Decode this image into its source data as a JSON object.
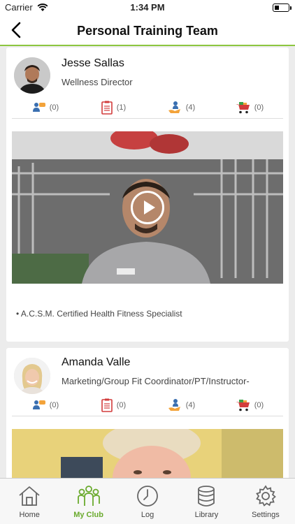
{
  "status_bar": {
    "carrier": "Carrier",
    "time": "1:34 PM"
  },
  "nav": {
    "title": "Personal Training Team"
  },
  "colors": {
    "accent": "#8cc63f",
    "active_tab": "#6aaa2d"
  },
  "trainers": [
    {
      "name": "Jesse Sallas",
      "title": "Wellness Director",
      "stats": {
        "messages": "(0)",
        "plans": "(1)",
        "sessions": "(4)",
        "store": "(0)"
      },
      "certification": "A.C.S.M. Certified Health Fitness Specialist"
    },
    {
      "name": "Amanda Valle",
      "title": "Marketing/Group Fit Coordinator/PT/Instructor-",
      "stats": {
        "messages": "(0)",
        "plans": "(0)",
        "sessions": "(4)",
        "store": "(0)"
      }
    }
  ],
  "tabs": [
    {
      "label": "Home",
      "icon": "home-icon"
    },
    {
      "label": "My Club",
      "icon": "my-club-icon",
      "active": true
    },
    {
      "label": "Log",
      "icon": "clock-icon"
    },
    {
      "label": "Library",
      "icon": "database-icon"
    },
    {
      "label": "Settings",
      "icon": "gear-icon"
    }
  ]
}
